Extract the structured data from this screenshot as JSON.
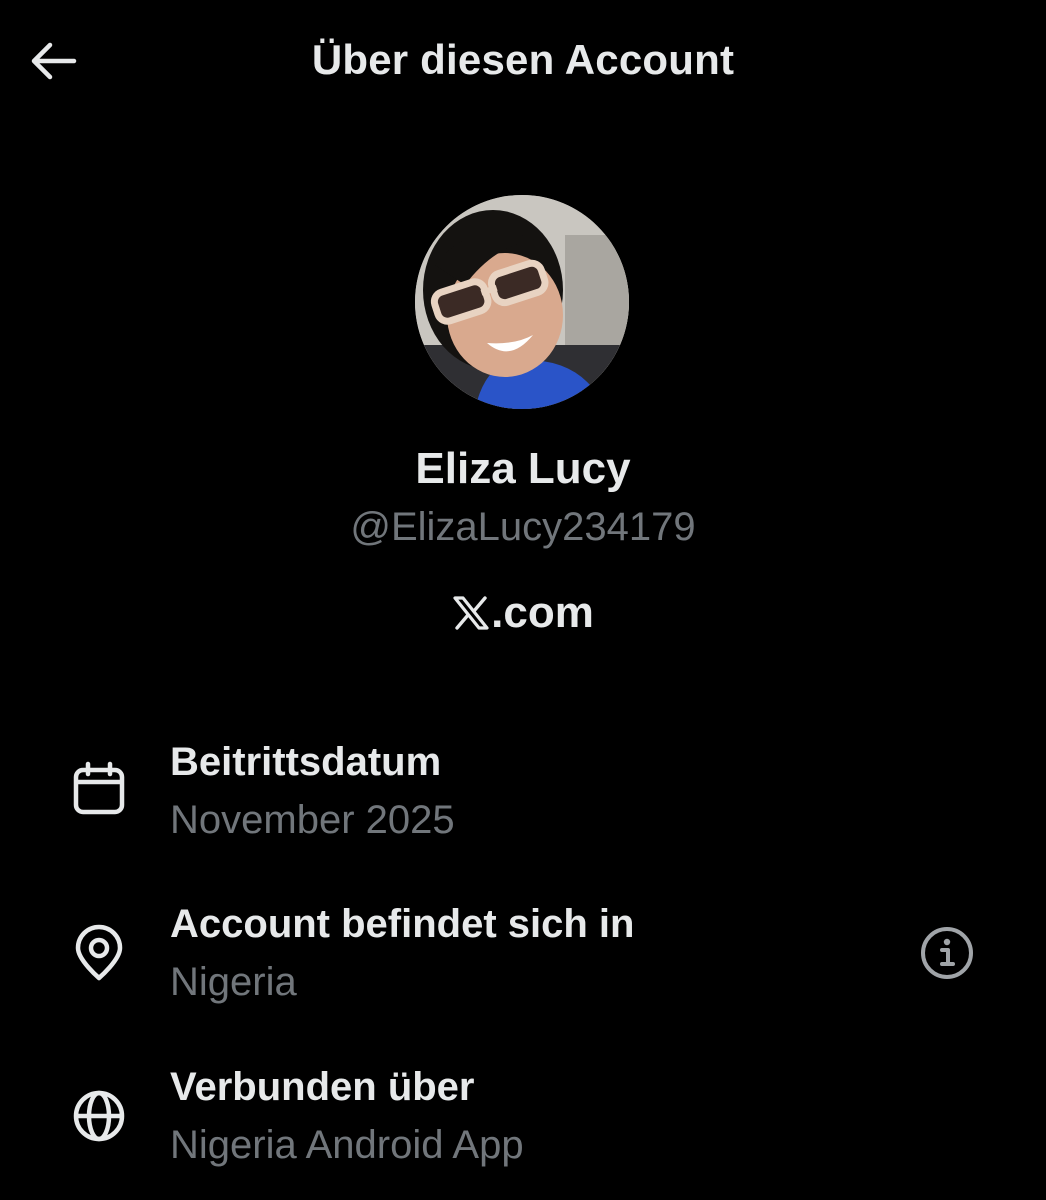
{
  "header": {
    "title": "Über diesen Account",
    "back_icon": "arrow-left-icon"
  },
  "profile": {
    "name": "Eliza Lucy",
    "handle": "@ElizaLucy234179",
    "platform_suffix": ".com",
    "platform_logo": "x-logo-icon"
  },
  "details": [
    {
      "icon": "calendar-icon",
      "label": "Beitrittsdatum",
      "value": "November 2025"
    },
    {
      "icon": "location-pin-icon",
      "label": "Account befindet sich in",
      "value": "Nigeria",
      "action_icon": "info-icon"
    },
    {
      "icon": "globe-icon",
      "label": "Verbunden über",
      "value": "Nigeria Android App"
    }
  ],
  "colors": {
    "background": "#000000",
    "primary_text": "#e7e9ea",
    "secondary_text": "#71767b"
  }
}
